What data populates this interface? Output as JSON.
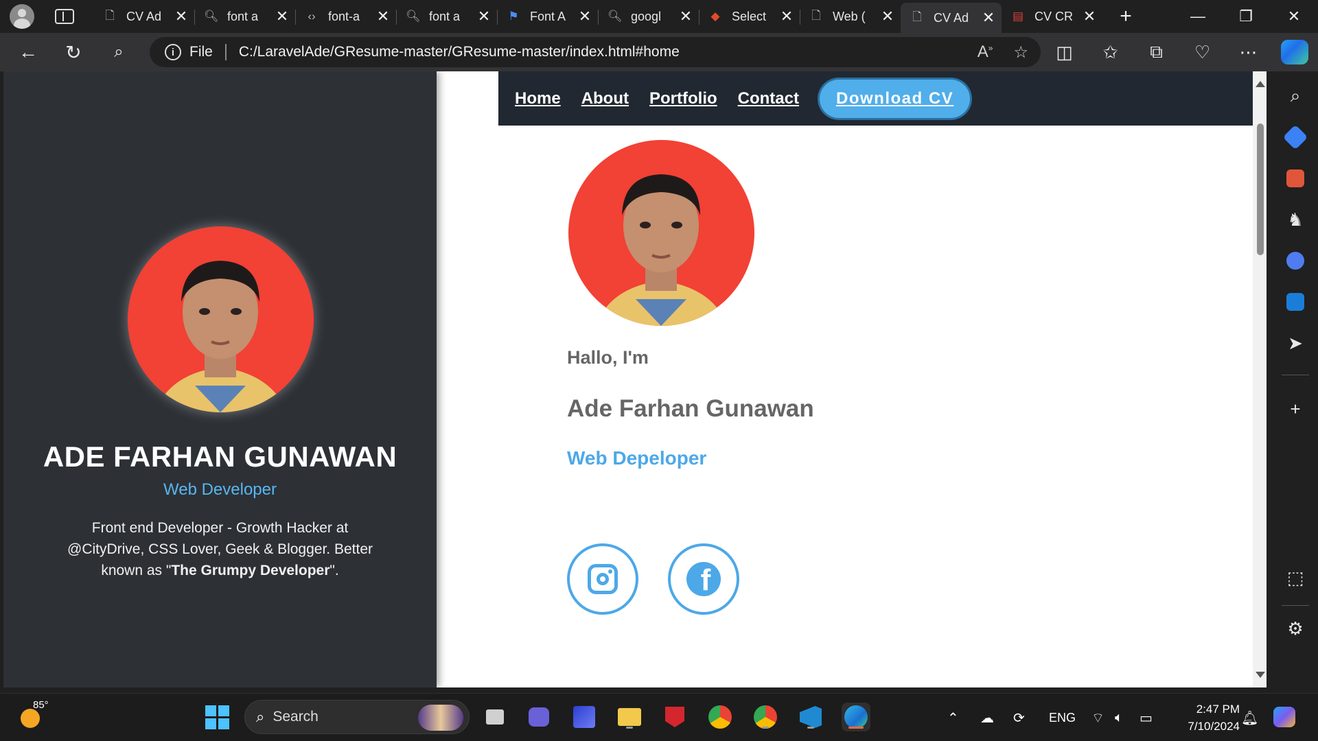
{
  "browser": {
    "tabs": [
      {
        "title": "CV Ad",
        "icon": "page-icon",
        "active": false
      },
      {
        "title": "font a",
        "icon": "search-icon",
        "active": false
      },
      {
        "title": "font-a",
        "icon": "code-icon",
        "active": false
      },
      {
        "title": "font a",
        "icon": "search-icon",
        "active": false
      },
      {
        "title": "Font A",
        "icon": "flag-icon",
        "active": false
      },
      {
        "title": "googl",
        "icon": "search-icon",
        "active": false
      },
      {
        "title": "Select",
        "icon": "site-icon",
        "active": false
      },
      {
        "title": "Web (",
        "icon": "page-icon",
        "active": false
      },
      {
        "title": "CV Ad",
        "icon": "page-icon",
        "active": true
      },
      {
        "title": "CV CR",
        "icon": "pdf-icon",
        "active": false
      }
    ],
    "address": {
      "scheme_label": "File",
      "url": "C:/LaravelAde/GResume-master/GResume-master/index.html#home"
    }
  },
  "page": {
    "sidebar": {
      "name": "ADE FARHAN GUNAWAN",
      "role": "Web Developer",
      "bio_prefix": "Front end Developer - Growth Hacker at @CityDrive, CSS Lover, Geek & Blogger. Better known as \"",
      "bio_bold": "The Grumpy Developer",
      "bio_suffix": "\"."
    },
    "nav": {
      "links": [
        "Home",
        "About",
        "Portfolio",
        "Contact"
      ],
      "download_label": "Download CV"
    },
    "hero": {
      "greeting": "Hallo, I'm",
      "name": "Ade Farhan Gunawan",
      "job": "Web Depeloper"
    },
    "social": [
      {
        "name": "instagram-icon"
      },
      {
        "name": "facebook-icon"
      }
    ]
  },
  "taskbar": {
    "weather_temp": "85°",
    "search_label": "Search",
    "language": "ENG",
    "time": "2:47 PM",
    "date": "7/10/2024"
  },
  "colors": {
    "accent_blue": "#4da8e8",
    "avatar_red": "#f24135",
    "sidebar_bg": "#2d3136",
    "navbar_bg": "#222831"
  }
}
